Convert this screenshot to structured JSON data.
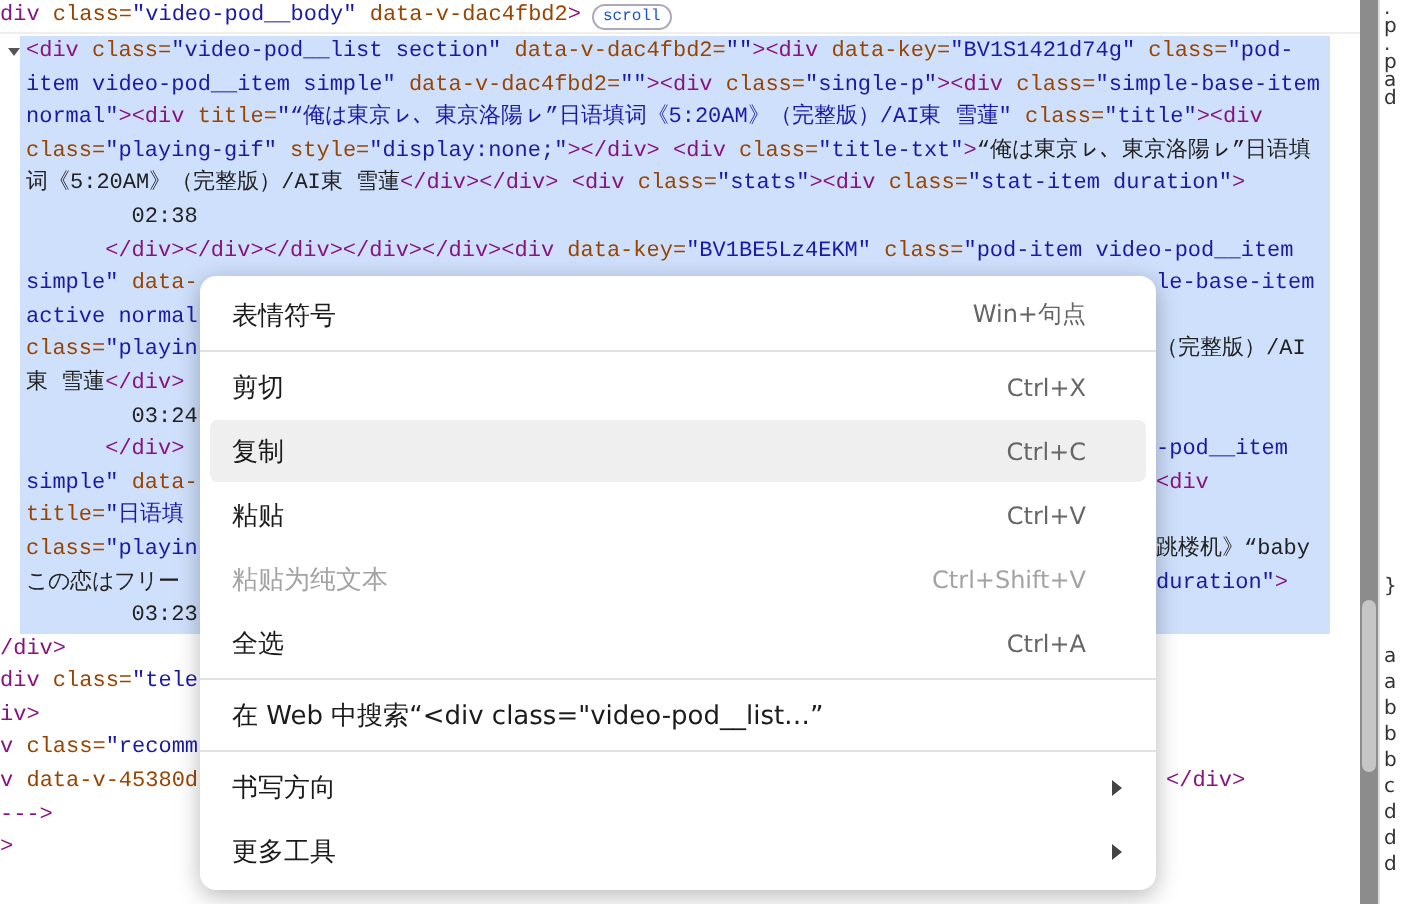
{
  "header_line": {
    "kind": "tagname",
    "text": "div class=\"video-pod__body\" data-v-dac4fbd2>",
    "badge": "scroll"
  },
  "selected_lines": [
    {
      "left": {
        "kind": "tagname",
        "text": "<div class=\"video-pod__list section\" data-v-dac4fbd2=\"\"><div data-key=\"BV1S1421d74g\" class=\"pod-"
      },
      "expanded": true
    },
    {
      "left": {
        "kind": "value",
        "text": "item video-pod__item simple\" data-v-dac4fbd2=\"\"><div class=\"single-p\"><div class=\"simple-base-item"
      }
    },
    {
      "left": {
        "kind": "value",
        "text": "normal\"><div title=\"“俺は東京ㇾ、東京洛陽ㇾ”日语填词《5:20AM》（完整版）/AI東 雪蓮\" class=\"title\"><div"
      }
    },
    {
      "left": {
        "kind": "tag",
        "text": "class=\"playing-gif\" style=\"display:none;\"></div> <div class=\"title-txt\">“俺は東京ㇾ、東京洛陽ㇾ”日语填"
      }
    },
    {
      "left": {
        "kind": "text",
        "text": "词《5:20AM》（完整版）/AI東 雪蓮</div></div> <div class=\"stats\"><div class=\"stat-item duration\">"
      }
    },
    {
      "left": {
        "kind": "text",
        "text": "        02:38"
      }
    },
    {
      "left": {
        "kind": "text",
        "text": "      </div></div></div></div></div><div data-key=\"BV1BE5Lz4EKM\" class=\"pod-item video-pod__item"
      }
    },
    {
      "left": {
        "kind": "value",
        "text": "simple\" data-"
      },
      "right": {
        "kind": "value",
        "text": "le-base-item"
      }
    },
    {
      "left": {
        "kind": "value",
        "text": "active normal"
      }
    },
    {
      "left": {
        "kind": "tag",
        "text": "class=\"playin"
      },
      "right": {
        "kind": "text",
        "text": "（完整版）/AI"
      }
    },
    {
      "left": {
        "kind": "text",
        "text": "東 雪蓮</div>"
      }
    },
    {
      "left": {
        "kind": "text",
        "text": "        03:24"
      }
    },
    {
      "left": {
        "kind": "text",
        "text": "      </div>"
      },
      "right": {
        "kind": "value",
        "text": "-pod__item"
      }
    },
    {
      "left": {
        "kind": "value",
        "text": "simple\" data-"
      },
      "right": {
        "kind": "text",
        "text": "<div"
      }
    },
    {
      "left": {
        "kind": "tag",
        "text": "title=\"日语填"
      }
    },
    {
      "left": {
        "kind": "tag",
        "text": "class=\"playin"
      },
      "right": {
        "kind": "text",
        "text": "跳楼机》“baby"
      }
    },
    {
      "left": {
        "kind": "text",
        "text": "この恋はフリー"
      },
      "right": {
        "kind": "value",
        "text": "duration\">"
      }
    },
    {
      "left": {
        "kind": "text",
        "text": "        03:23"
      }
    }
  ],
  "lines": [
    {
      "left": {
        "kind": "tagname",
        "text": "/div>"
      }
    },
    {
      "left": {
        "kind": "tagname",
        "text": "div class=\"tele"
      }
    },
    {
      "left": {
        "kind": "tagname",
        "text": "iv>"
      }
    },
    {
      "left": {
        "kind": "tagname",
        "text": "v class=\"recomm"
      }
    },
    {
      "left": {
        "kind": "tagname",
        "text": "v data-v-45380d"
      },
      "right": {
        "text": "</div>"
      }
    },
    {
      "left": {
        "kind": "tagname",
        "text": "--->"
      }
    },
    {
      "left": {
        "kind": "tagname",
        "text": ">"
      }
    }
  ],
  "styles_panel": {
    "top": [
      ".",
      "p",
      ".",
      "p",
      "a",
      "d"
    ],
    "brace": "}",
    "bottom": [
      "a",
      "a",
      "b",
      "b",
      "b",
      "c",
      "d",
      "d",
      "d"
    ]
  },
  "context_menu": [
    {
      "kind": "item",
      "label": "表情符号",
      "shortcut": "Win+句点",
      "selected": false,
      "disabled": false
    },
    {
      "kind": "separator"
    },
    {
      "kind": "item",
      "label": "剪切",
      "shortcut": "Ctrl+X",
      "selected": false,
      "disabled": false
    },
    {
      "kind": "item",
      "label": "复制",
      "shortcut": "Ctrl+C",
      "selected": true,
      "disabled": false
    },
    {
      "kind": "item",
      "label": "粘贴",
      "shortcut": "Ctrl+V",
      "selected": false,
      "disabled": false
    },
    {
      "kind": "item",
      "label": "粘贴为纯文本",
      "shortcut": "Ctrl+Shift+V",
      "selected": false,
      "disabled": true
    },
    {
      "kind": "item",
      "label": "全选",
      "shortcut": "Ctrl+A",
      "selected": false,
      "disabled": false
    },
    {
      "kind": "separator"
    },
    {
      "kind": "item",
      "label": "在 Web 中搜索“<div class=\"video-pod__list…”",
      "selected": false,
      "disabled": false
    },
    {
      "kind": "separator"
    },
    {
      "kind": "submenu",
      "label": "书写方向",
      "selected": false,
      "disabled": false
    },
    {
      "kind": "submenu",
      "label": "更多工具",
      "selected": false,
      "disabled": false
    }
  ]
}
